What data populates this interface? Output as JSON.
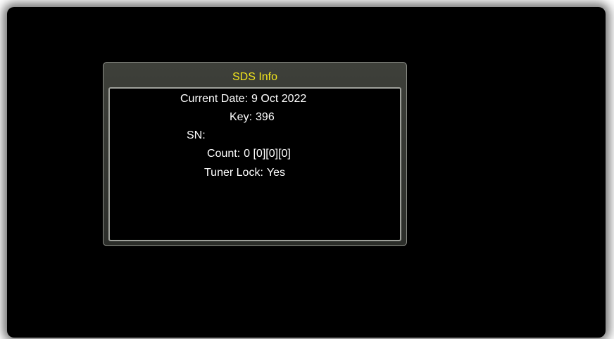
{
  "dialog": {
    "title": "SDS Info",
    "lines": [
      {
        "label": "Current Date:",
        "value": "9 Oct 2022"
      },
      {
        "label": "Key:",
        "value": "396"
      },
      {
        "label": "SN:",
        "value": ""
      },
      {
        "label": "Count:",
        "value": "0 [0][0][0]"
      },
      {
        "label": "Tuner Lock:",
        "value": "Yes"
      }
    ]
  },
  "colors": {
    "screen_background": "#000000",
    "title_text": "#f2e51c",
    "body_text": "#ffffff",
    "dialog_frame": "#3a3c37",
    "dialog_border": "#9fa19b"
  }
}
